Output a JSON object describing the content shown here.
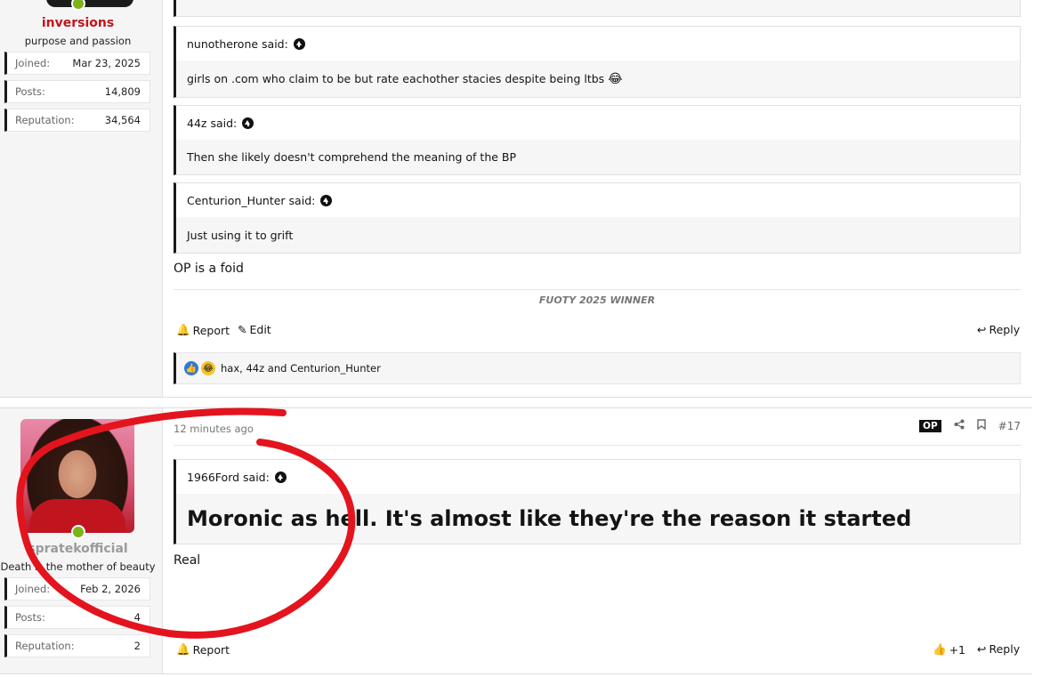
{
  "post1": {
    "username": "inversions",
    "user_title": "purpose and passion",
    "stats": [
      {
        "label": "Joined:",
        "value": "Mar 23, 2025"
      },
      {
        "label": "Posts:",
        "value": "14,809"
      },
      {
        "label": "Reputation:",
        "value": "34,564"
      }
    ],
    "quotes": [
      {
        "author": "nunotherone said:",
        "text": "girls on .com who claim to be but rate eachother stacies despite being ltbs",
        "emoji": "😂"
      },
      {
        "author": "44z said:",
        "text": "Then she likely doesn't comprehend the meaning of the BP"
      },
      {
        "author": "Centurion_Hunter said:",
        "text": "Just using it to grift"
      }
    ],
    "content": "OP is a foid",
    "signature": "FUOTY 2025 WINNER",
    "actions": {
      "report": "Report",
      "edit": "Edit",
      "reply": "Reply"
    },
    "reactions_text": "hax, 44z and Centurion_Hunter"
  },
  "post2": {
    "username": "spratekofficial",
    "user_title": "Death is the mother of beauty",
    "stats": [
      {
        "label": "Joined:",
        "value": "Feb 2, 2026"
      },
      {
        "label": "Posts:",
        "value": "4"
      },
      {
        "label": "Reputation:",
        "value": "2"
      }
    ],
    "timestamp": "12 minutes ago",
    "op_badge": "OP",
    "post_number": "#17",
    "quote": {
      "author": "1966Ford said:",
      "text": "Moronic as hell. It's almost like they're the reason it started"
    },
    "content": "Real",
    "actions": {
      "report": "Report",
      "like_count": "+1",
      "reply": "Reply"
    }
  },
  "colors": {
    "username_red": "#c0141e",
    "username_gray": "#9a9a9a",
    "online_green": "#7bb31a",
    "scribble_red": "#e3141e"
  }
}
